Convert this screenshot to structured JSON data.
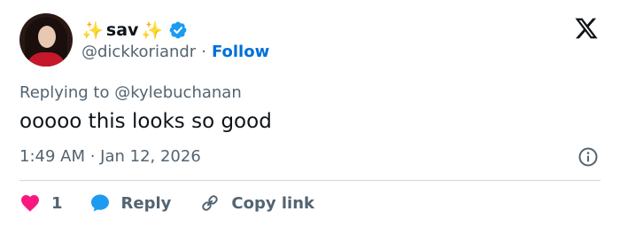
{
  "author": {
    "sparkle_left": "✨",
    "display_name": "sav",
    "sparkle_right": "✨",
    "handle": "@dickkoriandr",
    "separator": "·",
    "follow_label": "Follow"
  },
  "tweet": {
    "reply_context": "Replying to @kylebuchanan",
    "text": "ooooo this looks so good",
    "timestamp": "1:49 AM · Jan 12, 2026"
  },
  "actions": {
    "like_count": "1",
    "reply_label": "Reply",
    "copy_link_label": "Copy link"
  },
  "colors": {
    "like": "#f91880",
    "reply": "#1d9bf0",
    "follow": "#006fd6",
    "verified": "#1d9bf0",
    "secondary_text": "#536471"
  },
  "icons": {
    "verified": "verified-badge-icon",
    "platform": "x-logo-icon",
    "info": "info-icon",
    "like": "heart-icon",
    "reply": "speech-bubble-icon",
    "copy_link": "link-icon"
  }
}
